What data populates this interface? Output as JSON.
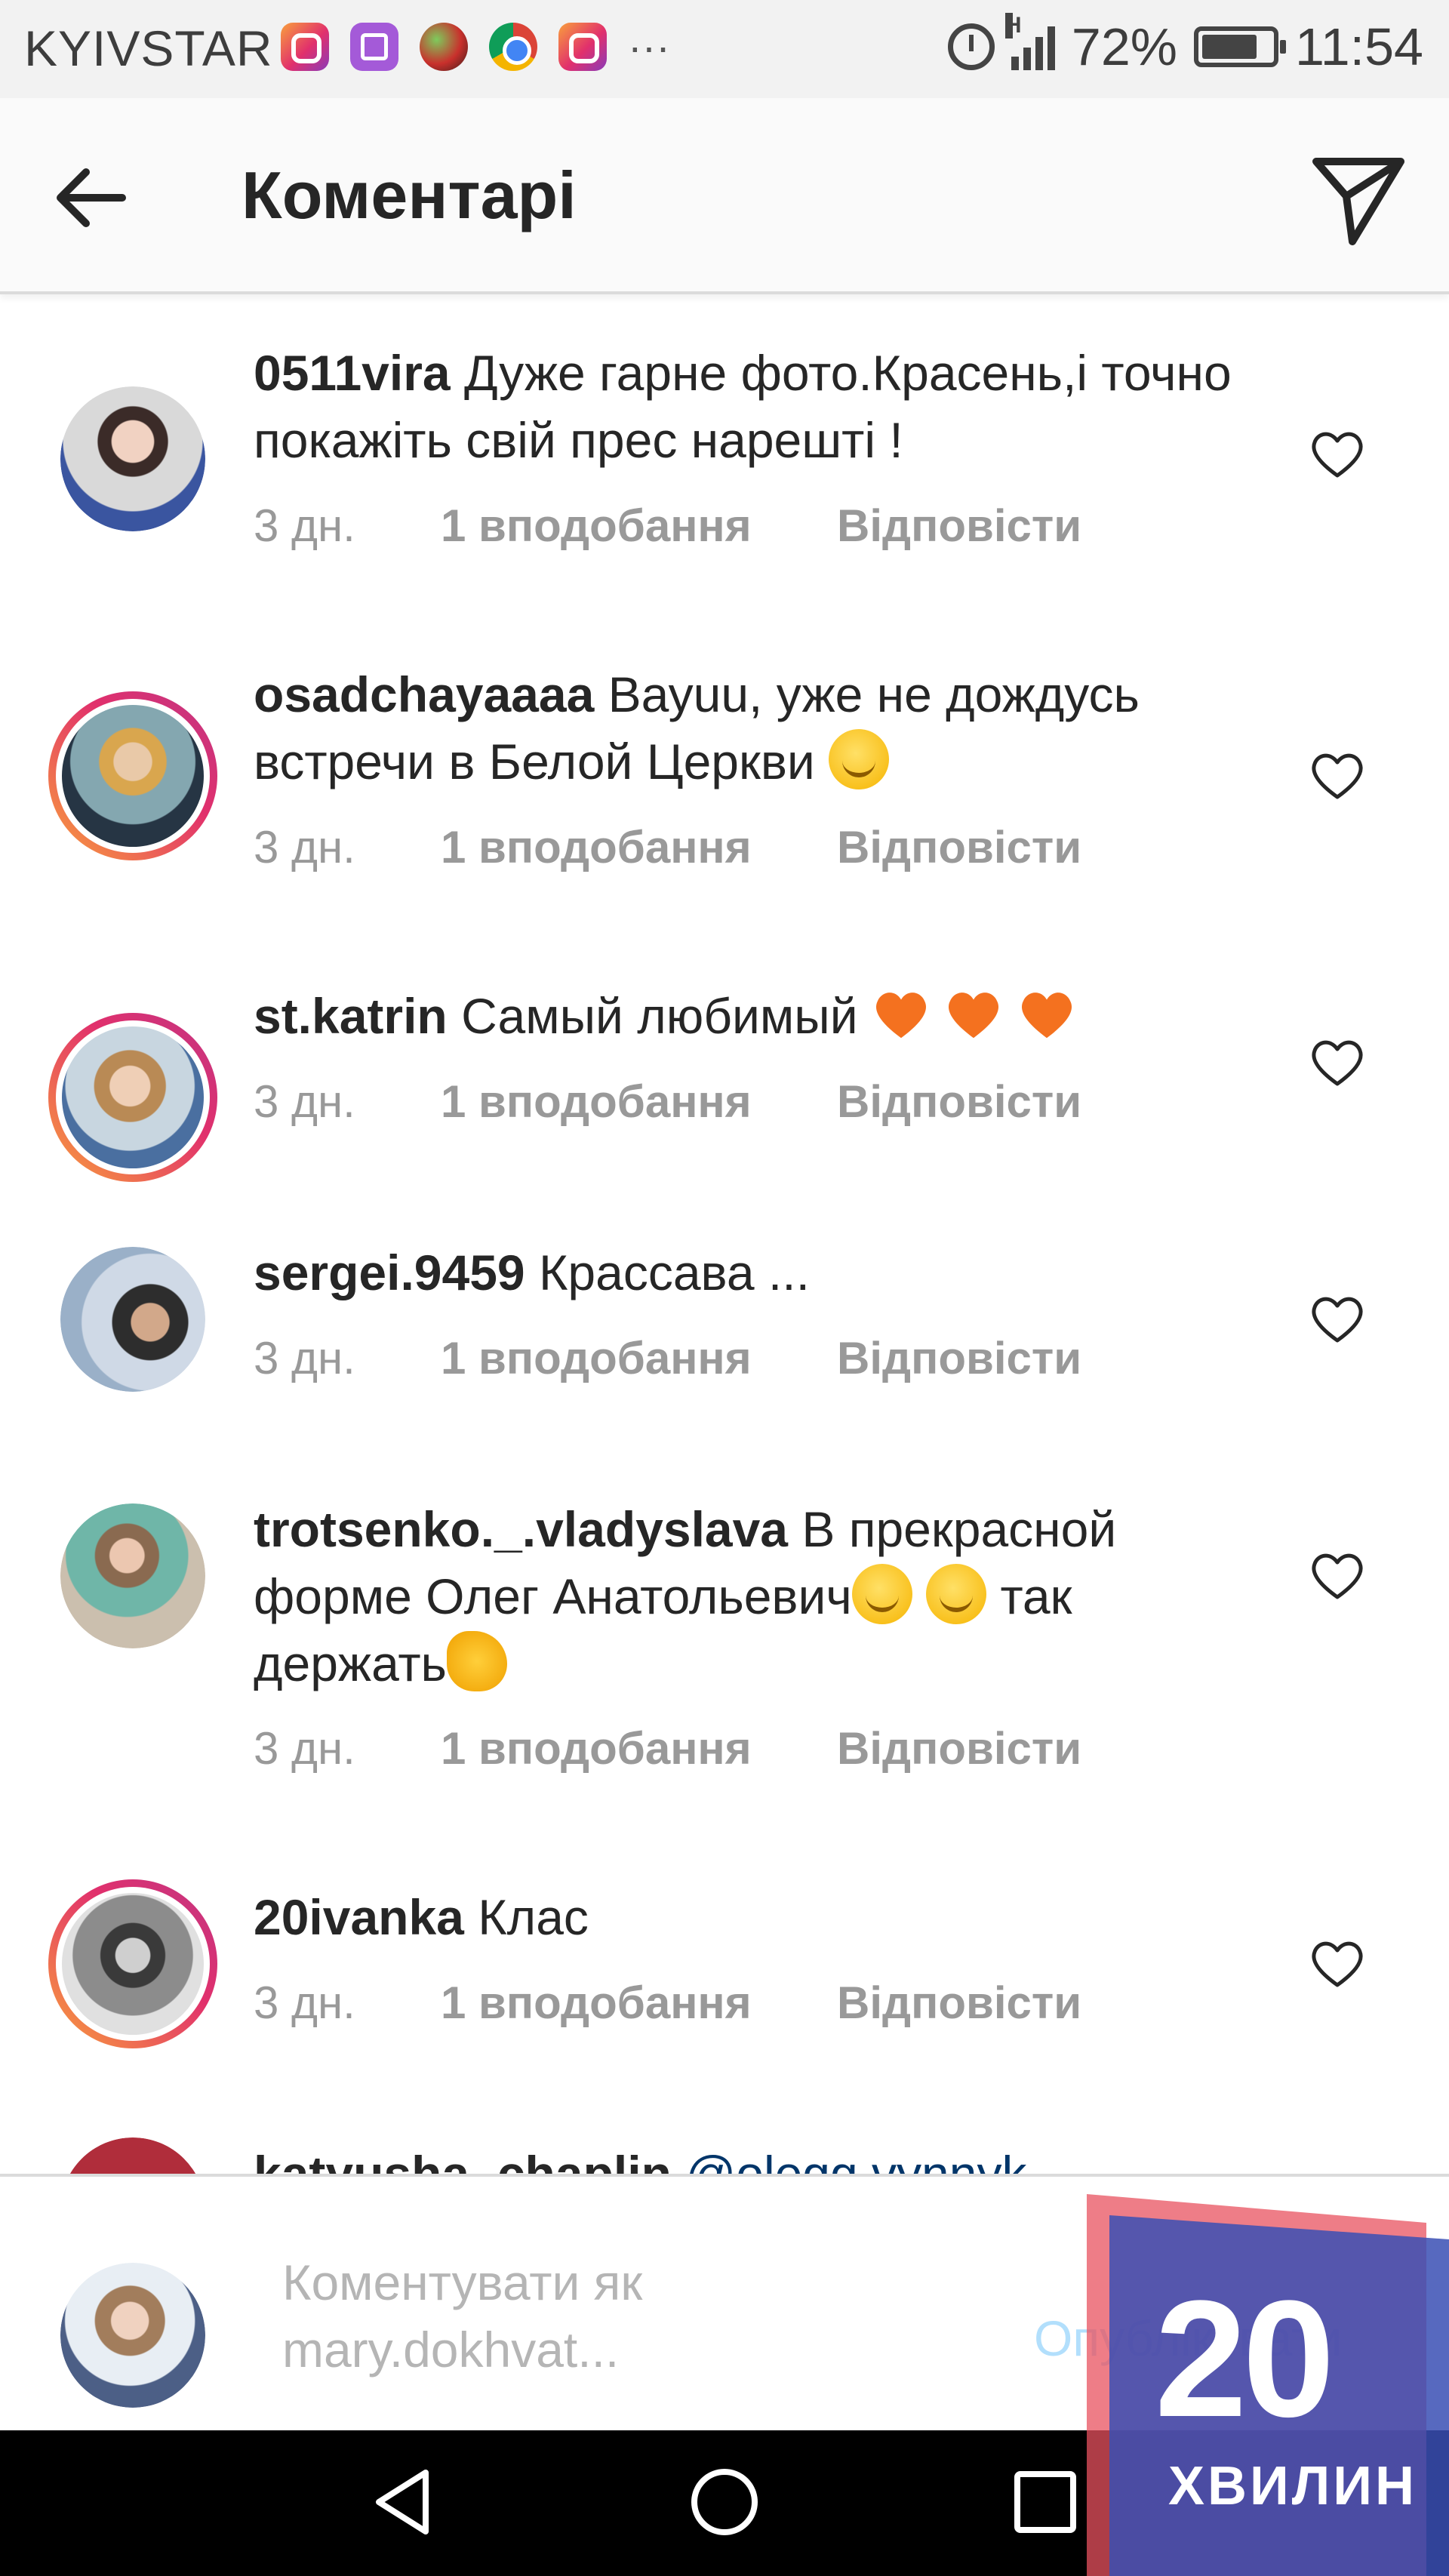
{
  "status_bar": {
    "carrier": "KYIVSTAR",
    "notification_icons": [
      "instagram-icon",
      "gallery-icon",
      "game-icon",
      "chrome-icon",
      "instagram-icon"
    ],
    "more": "···",
    "network_type": "H",
    "battery": "72%",
    "time": "11:54"
  },
  "header": {
    "title": "Коментарі"
  },
  "comments": [
    {
      "username": "0511vira",
      "text": "Дуже гарне фото.Красень,і точно покажіть свій прес нарешті !",
      "time": "3 дн.",
      "likes": "1 вподобання",
      "reply": "Відповісти",
      "has_story_ring": false
    },
    {
      "username": "osadchayaaaa",
      "text": "Вауuu, уже не дождусь встречи в Белой Церкви",
      "emoji": [
        "smiling-face"
      ],
      "time": "3 дн.",
      "likes": "1 вподобання",
      "reply": "Відповісти",
      "has_story_ring": true
    },
    {
      "username": "st.katrin",
      "text": "Самый любимый",
      "emoji": [
        "orange-heart",
        "orange-heart",
        "orange-heart"
      ],
      "time": "3 дн.",
      "likes": "1 вподобання",
      "reply": "Відповісти",
      "has_story_ring": true
    },
    {
      "username": "sergei.9459",
      "text": "Крассава ...",
      "time": "3 дн.",
      "likes": "1 вподобання",
      "reply": "Відповісти",
      "has_story_ring": false
    },
    {
      "username": "trotsenko._.vladyslava",
      "text": "В прекрасной форме Олег Анатольевич",
      "text_tail": "так держать",
      "emoji": [
        "eye-roll-face",
        "slight-smile-face",
        "flexed-biceps"
      ],
      "time": "3 дн.",
      "likes": "1 вподобання",
      "reply": "Відповісти",
      "has_story_ring": false
    },
    {
      "username": "20ivanka",
      "text": "Клас",
      "time": "3 дн.",
      "likes": "1 вподобання",
      "reply": "Відповісти",
      "has_story_ring": true
    },
    {
      "username": "katyusha_chaplin",
      "text": "@olegg.vynnyk",
      "partial": true
    }
  ],
  "compose": {
    "placeholder_line1": "Коментувати як",
    "placeholder_line2": "mary.dokhvat...",
    "publish_label": "Опублікувати"
  },
  "watermark": {
    "number": "20",
    "word": "ХВИЛИН"
  },
  "colors": {
    "story_ring_start": "#f9a03c",
    "story_ring_end": "#c13584",
    "meta_gray": "#999999",
    "publish_disabled": "#b2dffc",
    "orange_heart": "#f4711f"
  }
}
